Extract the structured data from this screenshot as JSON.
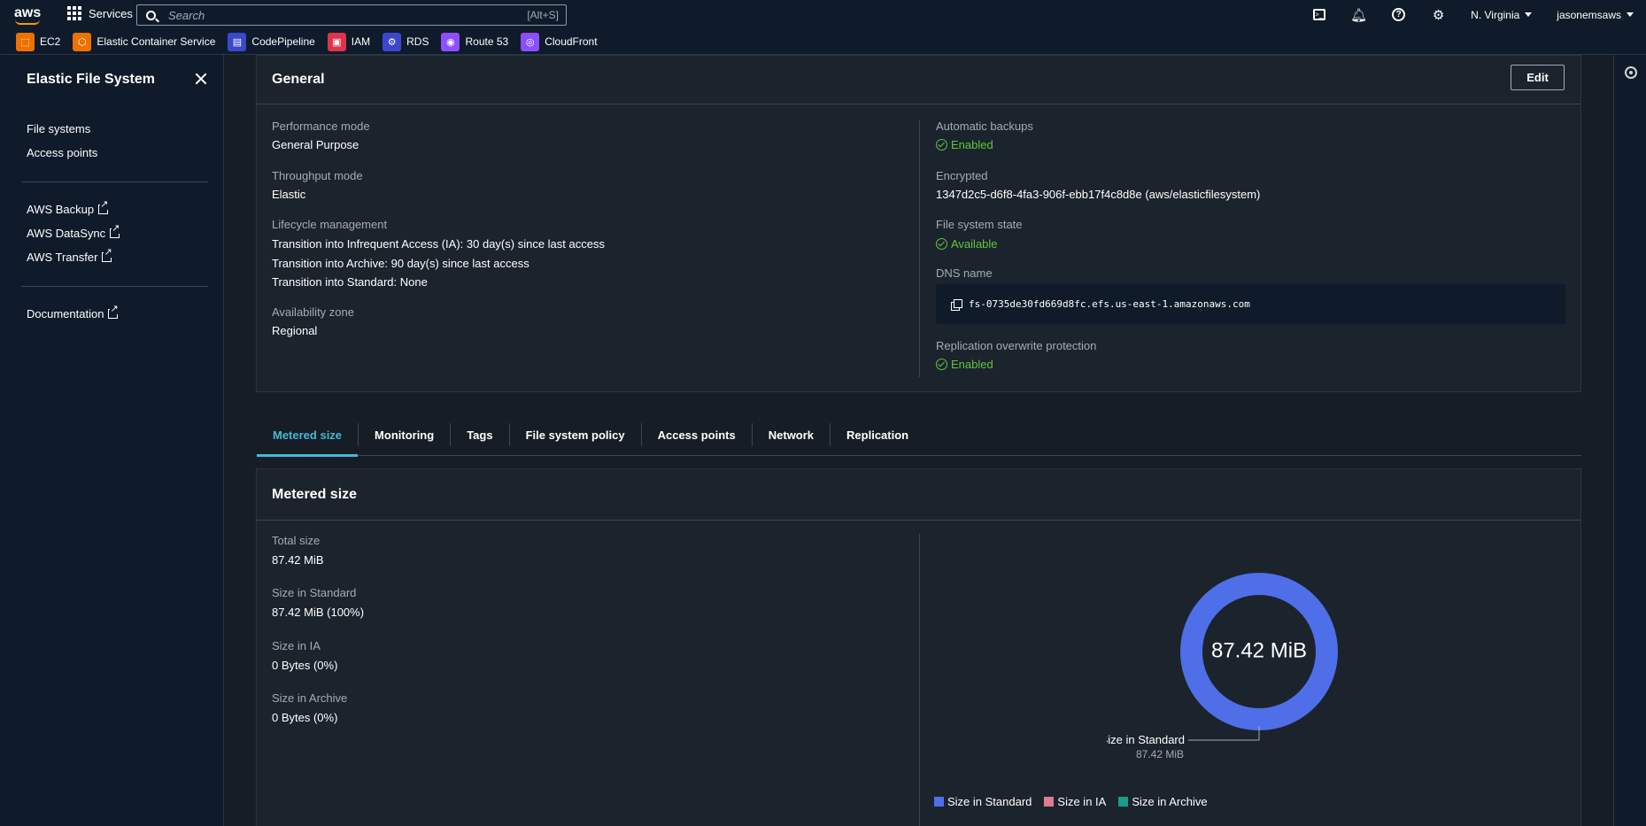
{
  "topnav": {
    "logo_text": "aws",
    "services_label": "Services",
    "search_placeholder": "Search",
    "search_shortcut": "[Alt+S]",
    "region": "N. Virginia",
    "user": "jasonemsaws"
  },
  "favorites": [
    {
      "label": "EC2",
      "icon": "ec2-icon",
      "color": "#ed7100"
    },
    {
      "label": "Elastic Container Service",
      "icon": "ecs-icon",
      "color": "#ed7100"
    },
    {
      "label": "CodePipeline",
      "icon": "codepipeline-icon",
      "color": "#3b48cc"
    },
    {
      "label": "IAM",
      "icon": "iam-icon",
      "color": "#dd344c"
    },
    {
      "label": "RDS",
      "icon": "rds-icon",
      "color": "#3b48cc"
    },
    {
      "label": "Route 53",
      "icon": "route53-icon",
      "color": "#8c4fff"
    },
    {
      "label": "CloudFront",
      "icon": "cloudfront-icon",
      "color": "#8c4fff"
    }
  ],
  "sidenav": {
    "title": "Elastic File System",
    "items": [
      "File systems",
      "Access points"
    ],
    "external": [
      "AWS Backup",
      "AWS DataSync",
      "AWS Transfer"
    ],
    "docs": "Documentation"
  },
  "general": {
    "title": "General",
    "edit_label": "Edit",
    "left": {
      "performance_mode_label": "Performance mode",
      "performance_mode": "General Purpose",
      "throughput_mode_label": "Throughput mode",
      "throughput_mode": "Elastic",
      "lifecycle_label": "Lifecycle management",
      "lifecycle_1": "Transition into Infrequent Access (IA): 30 day(s) since last access",
      "lifecycle_2": "Transition into Archive: 90 day(s) since last access",
      "lifecycle_3": "Transition into Standard: None",
      "az_label": "Availability zone",
      "az": "Regional"
    },
    "right": {
      "backups_label": "Automatic backups",
      "backups": "Enabled",
      "encrypted_label": "Encrypted",
      "encrypted": "1347d2c5-d6f8-4fa3-906f-ebb17f4c8d8e (aws/elasticfilesystem)",
      "state_label": "File system state",
      "state": "Available",
      "dns_label": "DNS name",
      "dns": "fs-0735de30fd669d8fc.efs.us-east-1.amazonaws.com",
      "replication_label": "Replication overwrite protection",
      "replication": "Enabled"
    }
  },
  "tabs": [
    "Metered size",
    "Monitoring",
    "Tags",
    "File system policy",
    "Access points",
    "Network",
    "Replication"
  ],
  "metered": {
    "title": "Metered size",
    "total_label": "Total size",
    "total": "87.42 MiB",
    "standard_label": "Size in Standard",
    "standard": "87.42 MiB (100%)",
    "ia_label": "Size in IA",
    "ia": "0 Bytes (0%)",
    "archive_label": "Size in Archive",
    "archive": "0 Bytes (0%)",
    "donut_center": "87.42 MiB",
    "callout_label": "Size in Standard",
    "callout_value": "87.42 MiB",
    "legend": [
      {
        "label": "Size in Standard",
        "color": "#4f6fe8"
      },
      {
        "label": "Size in IA",
        "color": "#e07b95"
      },
      {
        "label": "Size in Archive",
        "color": "#1a9a87"
      }
    ]
  },
  "chart_data": {
    "type": "pie",
    "categories": [
      "Size in Standard",
      "Size in IA",
      "Size in Archive"
    ],
    "values": [
      87.42,
      0,
      0
    ],
    "unit": "MiB",
    "title": "",
    "center_label": "87.42 MiB"
  }
}
